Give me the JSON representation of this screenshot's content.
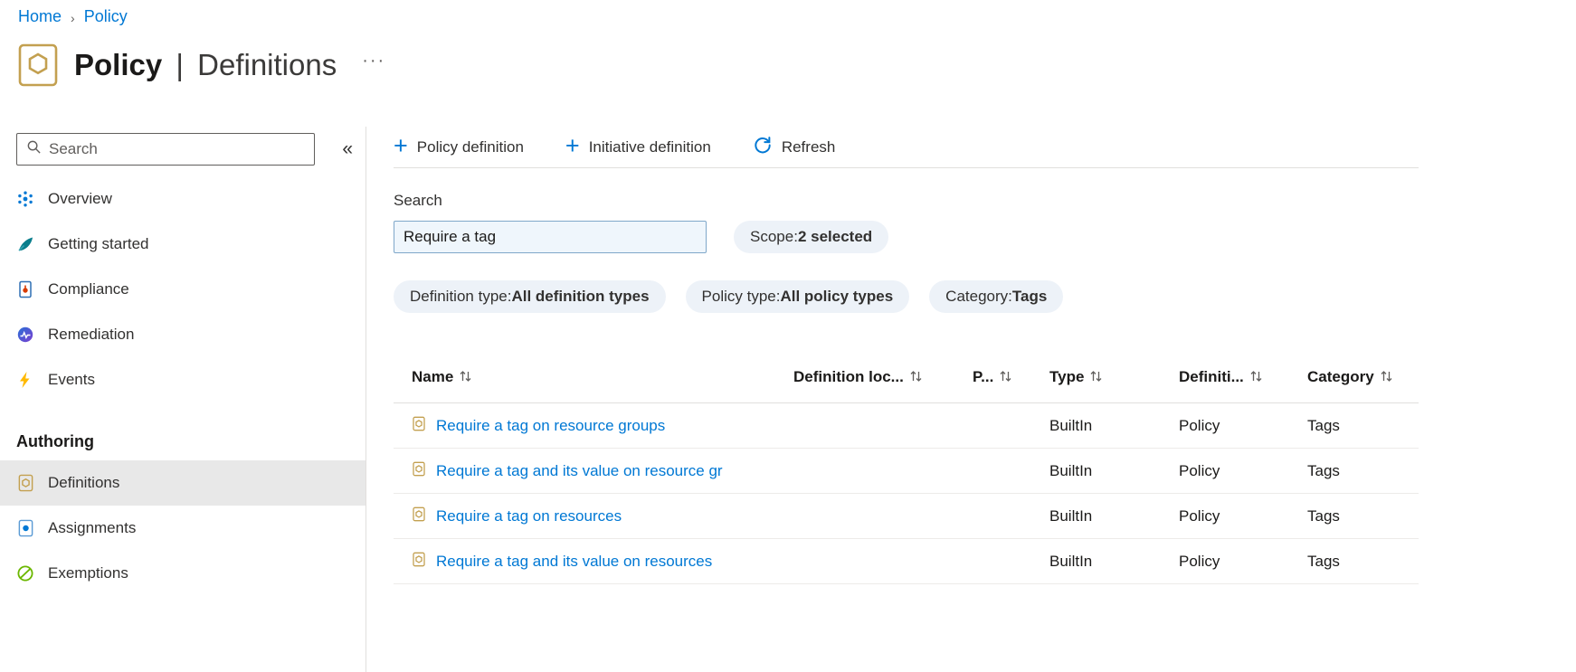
{
  "colors": {
    "accent": "#0078d4",
    "link": "#0078d4",
    "pill_background": "#edf2f8",
    "search_fill": "#eff6fc",
    "selected_item_background": "#e8e8e8",
    "events_icon": "#ffb900",
    "exemptions_icon": "#6bb700",
    "policy_icon": "#c3a050"
  },
  "icons": {
    "breadcrumb-chevron": "›",
    "collapse-sidebar": "«",
    "more": "···",
    "plus": "+",
    "search": "magnifier",
    "sort": "up-down-arrows",
    "page": "policy-document-hexagon",
    "overview": "dots-circle",
    "getting-started": "paper-plane",
    "compliance": "document-orange-dot",
    "remediation": "pulse-circle",
    "events": "lightning-bolt",
    "definitions": "policy-document",
    "assignments": "document-blue-dot",
    "exemptions": "circle-slash",
    "refresh": "circular-arrow"
  },
  "breadcrumb": {
    "items": [
      "Home",
      "Policy"
    ]
  },
  "header": {
    "title": "Policy",
    "separator": "|",
    "subtitle": "Definitions"
  },
  "sidebar": {
    "search_placeholder": "Search",
    "items": [
      {
        "label": "Overview"
      },
      {
        "label": "Getting started"
      },
      {
        "label": "Compliance"
      },
      {
        "label": "Remediation"
      },
      {
        "label": "Events"
      }
    ],
    "section_heading": "Authoring",
    "authoring_items": [
      {
        "label": "Definitions",
        "selected": true
      },
      {
        "label": "Assignments",
        "selected": false
      },
      {
        "label": "Exemptions",
        "selected": false
      }
    ]
  },
  "toolbar": {
    "items": [
      {
        "label": "Policy definition"
      },
      {
        "label": "Initiative definition"
      },
      {
        "label": "Refresh"
      }
    ]
  },
  "filters": {
    "search_label": "Search",
    "search_value": "Require a tag",
    "separator": " : ",
    "pills": [
      {
        "name": "Scope",
        "value": "2 selected"
      },
      {
        "name": "Definition type",
        "value": "All definition types"
      },
      {
        "name": "Policy type",
        "value": "All policy types"
      },
      {
        "name": "Category",
        "value": "Tags"
      }
    ]
  },
  "table": {
    "columns": [
      {
        "label": "Name"
      },
      {
        "label": "Definition loc..."
      },
      {
        "label": "P..."
      },
      {
        "label": "Type"
      },
      {
        "label": "Definiti..."
      },
      {
        "label": "Category"
      }
    ],
    "rows": [
      {
        "name": "Require a tag on resource groups",
        "definition_location": "",
        "type": "BuiltIn",
        "definition_type": "Policy",
        "category": "Tags"
      },
      {
        "name": "Require a tag and its value on resource gr",
        "definition_location": "",
        "type": "BuiltIn",
        "definition_type": "Policy",
        "category": "Tags"
      },
      {
        "name": "Require a tag on resources",
        "definition_location": "",
        "type": "BuiltIn",
        "definition_type": "Policy",
        "category": "Tags"
      },
      {
        "name": "Require a tag and its value on resources",
        "definition_location": "",
        "type": "BuiltIn",
        "definition_type": "Policy",
        "category": "Tags"
      }
    ]
  }
}
